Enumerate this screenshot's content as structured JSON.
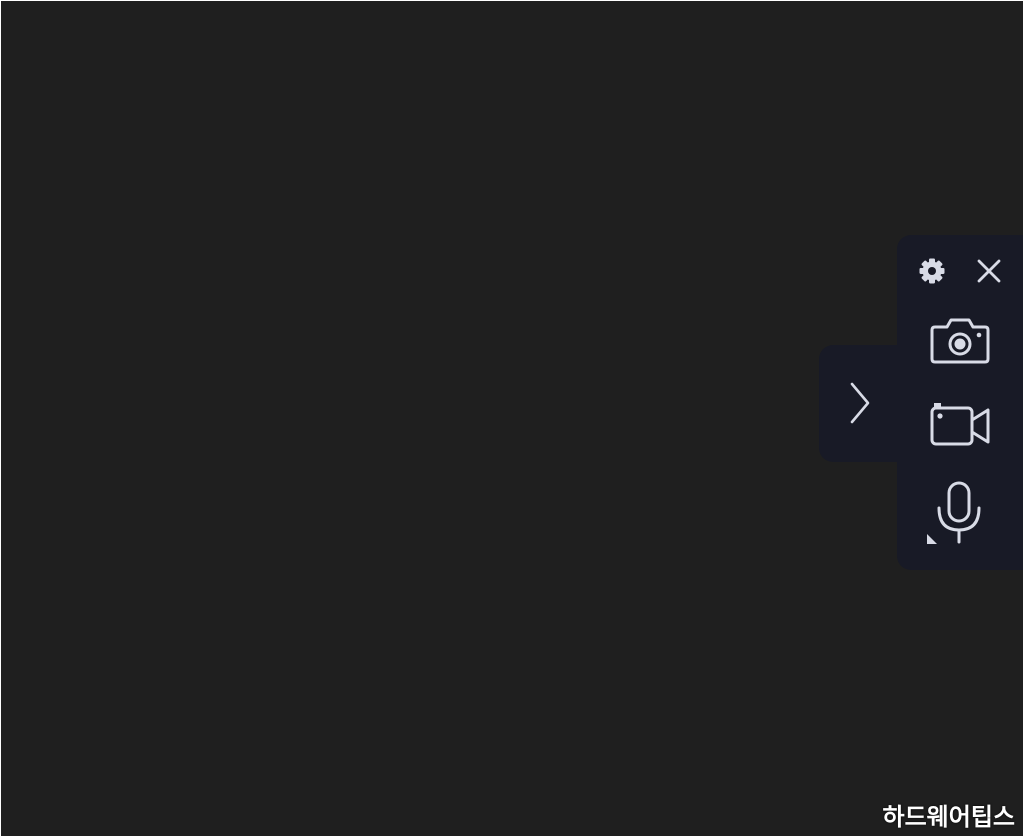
{
  "colors": {
    "background": "#1f1f1f",
    "toolbar": "#181a26",
    "icon": "#d8dbe6"
  },
  "toolbar": {
    "icons": {
      "settings": "gear-icon",
      "close": "close-icon",
      "screenshot": "camera-icon",
      "record": "video-camera-icon",
      "audio": "microphone-icon",
      "expand": "chevron-right-icon"
    }
  },
  "watermark": {
    "text": "하드웨어팁스"
  }
}
